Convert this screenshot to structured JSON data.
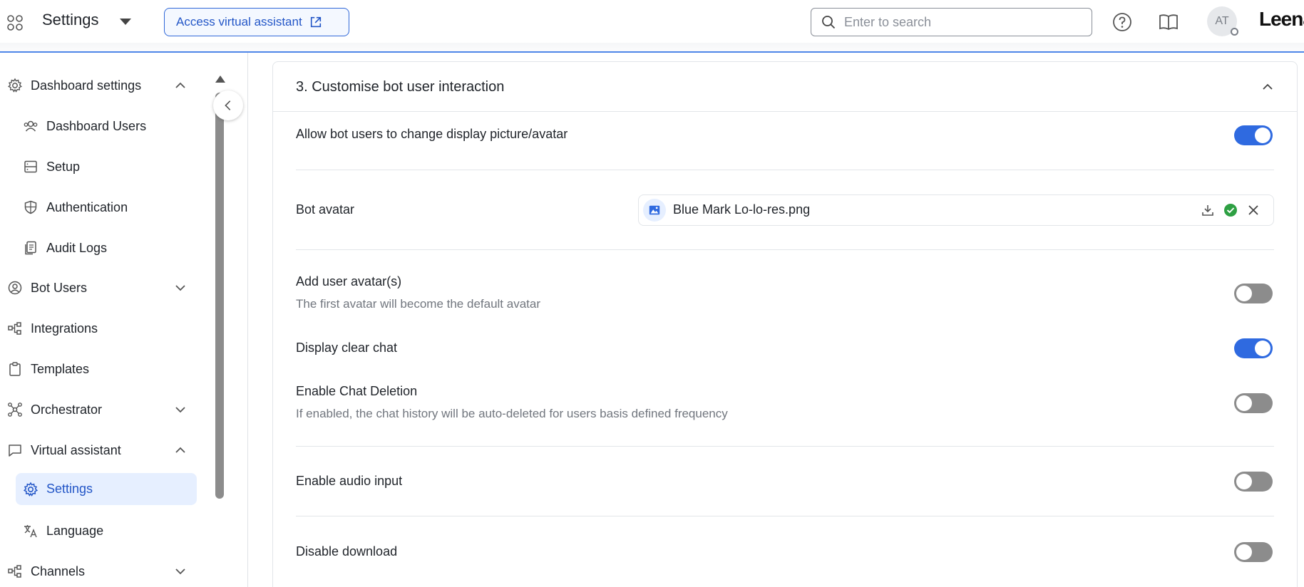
{
  "topbar": {
    "title": "Settings",
    "assistant_button": "Access virtual assistant",
    "search_placeholder": "Enter to search",
    "avatar_initials": "AT",
    "logo_text": "Leena"
  },
  "sidebar": {
    "items": [
      {
        "label": "Dashboard settings"
      },
      {
        "label": "Dashboard Users"
      },
      {
        "label": "Setup"
      },
      {
        "label": "Authentication"
      },
      {
        "label": "Audit Logs"
      },
      {
        "label": "Bot Users"
      },
      {
        "label": "Integrations"
      },
      {
        "label": "Templates"
      },
      {
        "label": "Orchestrator"
      },
      {
        "label": "Virtual assistant"
      },
      {
        "label": "Settings"
      },
      {
        "label": "Language"
      },
      {
        "label": "Channels"
      }
    ]
  },
  "section": {
    "title": "3. Customise bot user interaction",
    "rows": [
      {
        "label": "Allow bot users to change display picture/avatar",
        "enabled": true
      },
      {
        "label": "Bot avatar",
        "file_name": "Blue Mark Lo-lo-res.png"
      },
      {
        "label": "Add user avatar(s)",
        "description": "The first avatar will become the default avatar",
        "enabled": false
      },
      {
        "label": "Display clear chat",
        "enabled": true
      },
      {
        "label": "Enable Chat Deletion",
        "description": "If enabled, the chat history will be auto-deleted for users basis defined frequency",
        "enabled": false
      },
      {
        "label": "Enable audio input",
        "enabled": false
      },
      {
        "label": "Disable download",
        "enabled": false
      }
    ]
  },
  "colors": {
    "accent": "#2f6ae0",
    "active_bg": "#e6efff",
    "toggle_off": "#8c8c8c",
    "success": "#2ea043"
  }
}
